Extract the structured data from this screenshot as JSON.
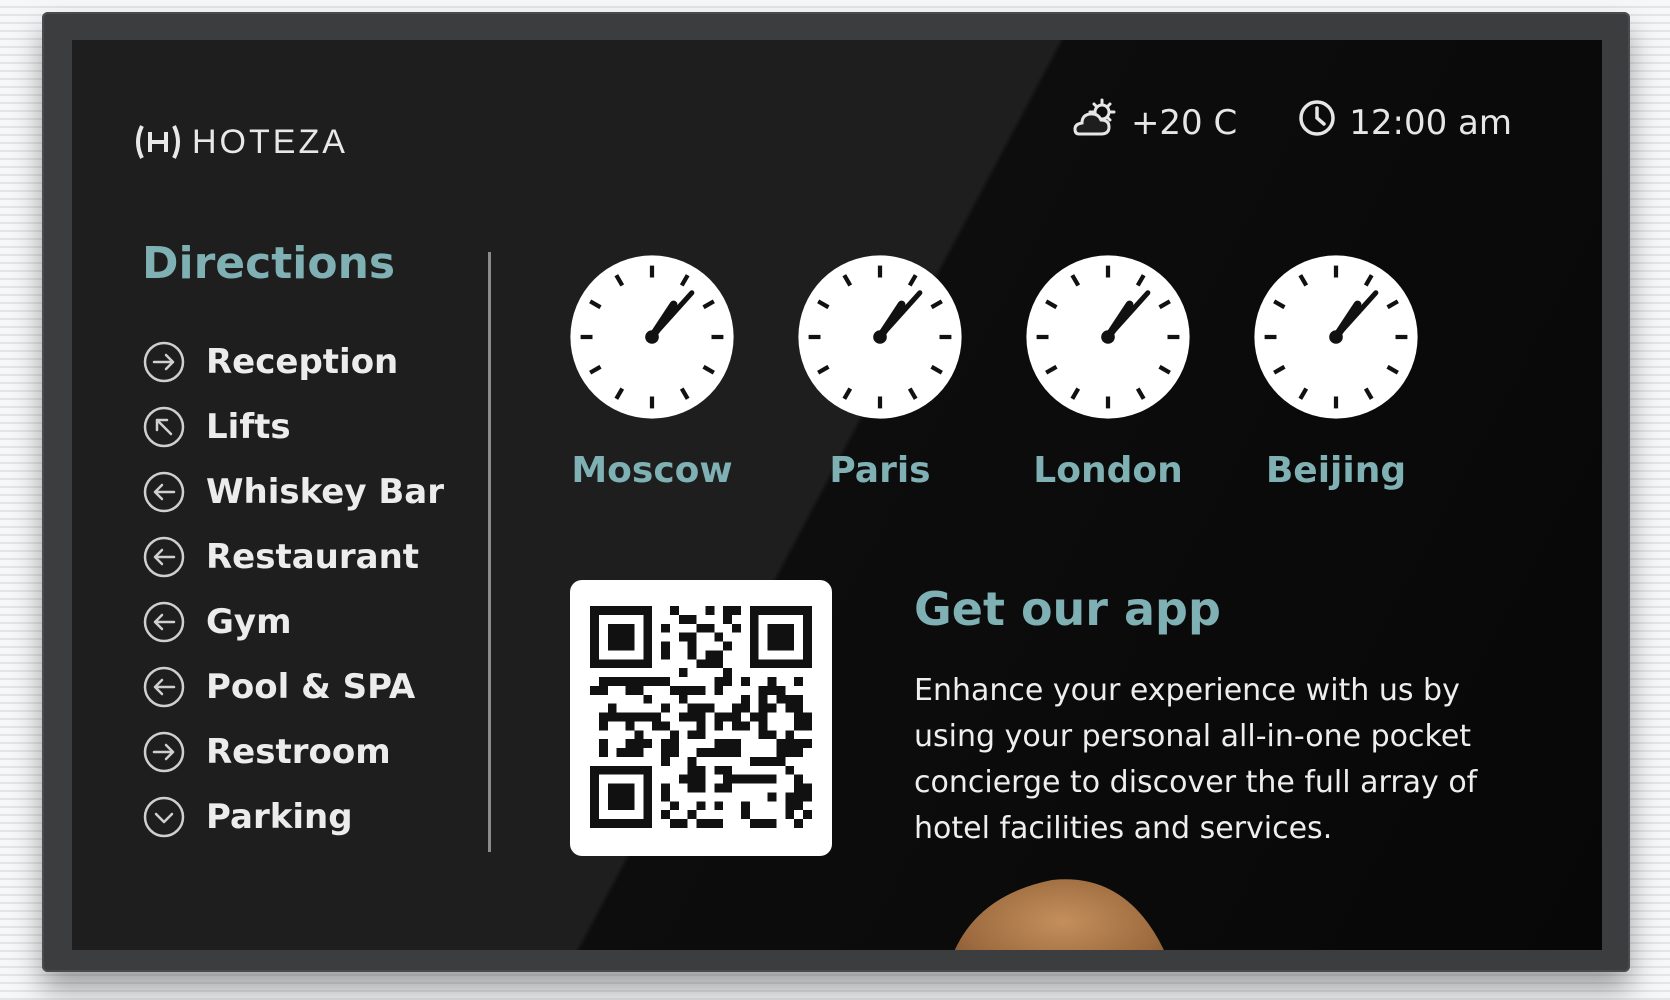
{
  "brand": {
    "logo_text": "HOTEZA"
  },
  "status": {
    "temperature": "+20 C",
    "time": "12:00 am",
    "weather_icon": "cloud-sun-icon",
    "time_icon": "clock-icon"
  },
  "directions": {
    "title": "Directions",
    "items": [
      {
        "label": "Reception",
        "icon": "arrow-right-circle-icon"
      },
      {
        "label": "Lifts",
        "icon": "arrow-up-left-circle-icon"
      },
      {
        "label": "Whiskey Bar",
        "icon": "arrow-left-circle-icon"
      },
      {
        "label": "Restaurant",
        "icon": "arrow-left-circle-icon"
      },
      {
        "label": "Gym",
        "icon": "arrow-left-circle-icon"
      },
      {
        "label": "Pool & SPA",
        "icon": "arrow-left-circle-icon"
      },
      {
        "label": "Restroom",
        "icon": "arrow-right-circle-icon"
      },
      {
        "label": "Parking",
        "icon": "arrow-down-circle-icon"
      }
    ]
  },
  "clocks": [
    {
      "city": "Moscow",
      "time": "1:07"
    },
    {
      "city": "Paris",
      "time": "1:07"
    },
    {
      "city": "London",
      "time": "1:07"
    },
    {
      "city": "Beijing",
      "time": "1:07"
    }
  ],
  "app_promo": {
    "title": "Get our app",
    "description": "Enhance your experience with us by using your personal all-in-one pocket concierge to discover the full array of hotel facilities and services."
  },
  "colors": {
    "accent": "#7fb0b3",
    "screen_bg": "#1e1e1e",
    "text": "#eeeeee"
  }
}
